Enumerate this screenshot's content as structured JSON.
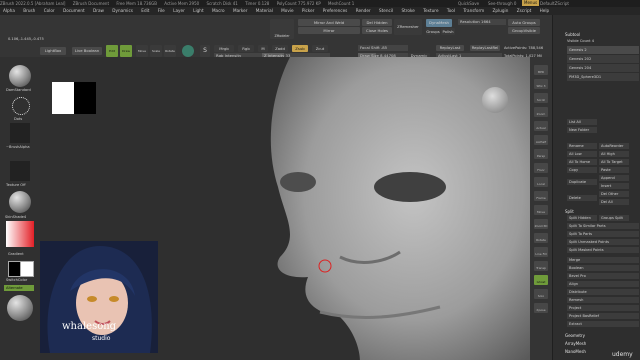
{
  "titlebar": {
    "items": [
      "ZBrush 2022.0.5 [Abraham Leal]",
      "ZBrush Document",
      "Free Mem 18.736GB",
      "Active Mem 2950",
      "Scratch Disk 41",
      "Timer 0.128",
      "PolyCount 775.972 KP",
      "MeshCount 1"
    ],
    "right": [
      "QuickSave",
      "See-through 0",
      "Menus",
      "DefaultZScript"
    ]
  },
  "menubar": {
    "items": [
      "Alpha",
      "Brush",
      "Color",
      "Document",
      "Draw",
      "Dynamics",
      "Edit",
      "File",
      "Layer",
      "Light",
      "Macro",
      "Marker",
      "Material",
      "Movie",
      "Picker",
      "Preferences",
      "Render",
      "Stencil",
      "Stroke",
      "Texture",
      "Tool",
      "Transform",
      "Zplugin",
      "Zscript",
      "Help"
    ]
  },
  "shelf": {
    "coord": "0.106,-1.445,-0.475",
    "lightbox": "LightBox",
    "live_boolean": "Live Boolean",
    "edit": "Edit",
    "draw": "Draw",
    "move": "Move",
    "scale": "Scale",
    "rotate": "Rotate",
    "mrgb": "Mrgb",
    "rgb": "Rgb",
    "m": "M",
    "zadd": "Zadd",
    "zsub": "Zsub",
    "zcut": "Zcut",
    "rgb_intensity": "Rgb Intensity",
    "z_intensity": "Z Intensity 33",
    "z_intensity_level": 0.33,
    "focal_shift": "Focal Shift -85",
    "draw_size": "Draw Size 8.44708",
    "draw_size_level": 0.35,
    "dynamic": "Dynamic",
    "replay_last": "ReplayLast",
    "replay_last_rel": "ReplayLastRel",
    "adjust_last": "AdjustLast 1",
    "active_points": "ActivePoints: 788,546",
    "total_points": "TotalPoints: 1.027 Mil",
    "zmodeler": "ZModeler",
    "mirror_and_weld": "Mirror And Weld",
    "mirror": "Mirror",
    "del_hidden": "Del Hidden",
    "close_holes": "Close Holes",
    "zremesher": "ZRemesher",
    "dynamesh": "DynaMesh",
    "groups": "Groups",
    "polish": "Polish",
    "resolution": "Resolution 1664",
    "auto_groups": "Auto Groups",
    "group_visible": "GroupVisible"
  },
  "left_shelf": {
    "brush": "DamStandard",
    "stroke": "Dots",
    "alpha": "~BrushAlpha",
    "texture": "Texture Off",
    "material": "SkinShade4",
    "gradient": "Gradient",
    "switch_color": "SwitchColor",
    "alternate": "Alternate"
  },
  "video": {
    "brand": "whalesong",
    "sub": "studio"
  },
  "right_tool": {
    "items": [
      "BPR",
      "SPix 3",
      "Scroll",
      "Zoom",
      "Actual",
      "AAHalf",
      "Persp",
      "Floor",
      "Local",
      "Frame",
      "Move",
      "Zoom3D",
      "Rotate",
      "Line Fill",
      "Transp",
      "Ghost",
      "Solo",
      "Xpose"
    ]
  },
  "subtool": {
    "head": "Subtool",
    "visible_count": "Visible Count 4",
    "items": [
      "Genesis 2",
      "Genesis 202",
      "Genesis 204",
      "PM3D_Sphere3D1"
    ],
    "list_all": "List All",
    "new_folder": "New Folder",
    "rename": "Rename",
    "auto_reorder": "AutoReorder",
    "all_low": "All Low",
    "all_high": "All High",
    "all_to_home": "All To Home",
    "all_to_target": "All To Target",
    "copy": "Copy",
    "paste": "Paste",
    "append": "Append",
    "duplicate": "Duplicate",
    "insert": "Insert",
    "del_other": "Del Other",
    "delete": "Delete",
    "del_all": "Del All",
    "split_head": "Split",
    "split_hidden": "Split Hidden",
    "groups_split": "Groups Split",
    "split_similar": "Split To Similar Parts",
    "split_parts": "Split To Parts",
    "split_unmasked": "Split Unmasked Points",
    "split_masked": "Split Masked Points",
    "merge": "Merge",
    "boolean": "Boolean",
    "bevel_pro": "Bevel Pro",
    "align": "Align",
    "distribute": "Distribute",
    "remesh": "Remesh",
    "project": "Project",
    "project_bas_relief": "Project BasRelief",
    "extract": "Extract",
    "geometry": "Geometry",
    "array_mesh": "ArrayMesh",
    "nano_mesh": "NanoMesh"
  },
  "watermark": "udemy"
}
